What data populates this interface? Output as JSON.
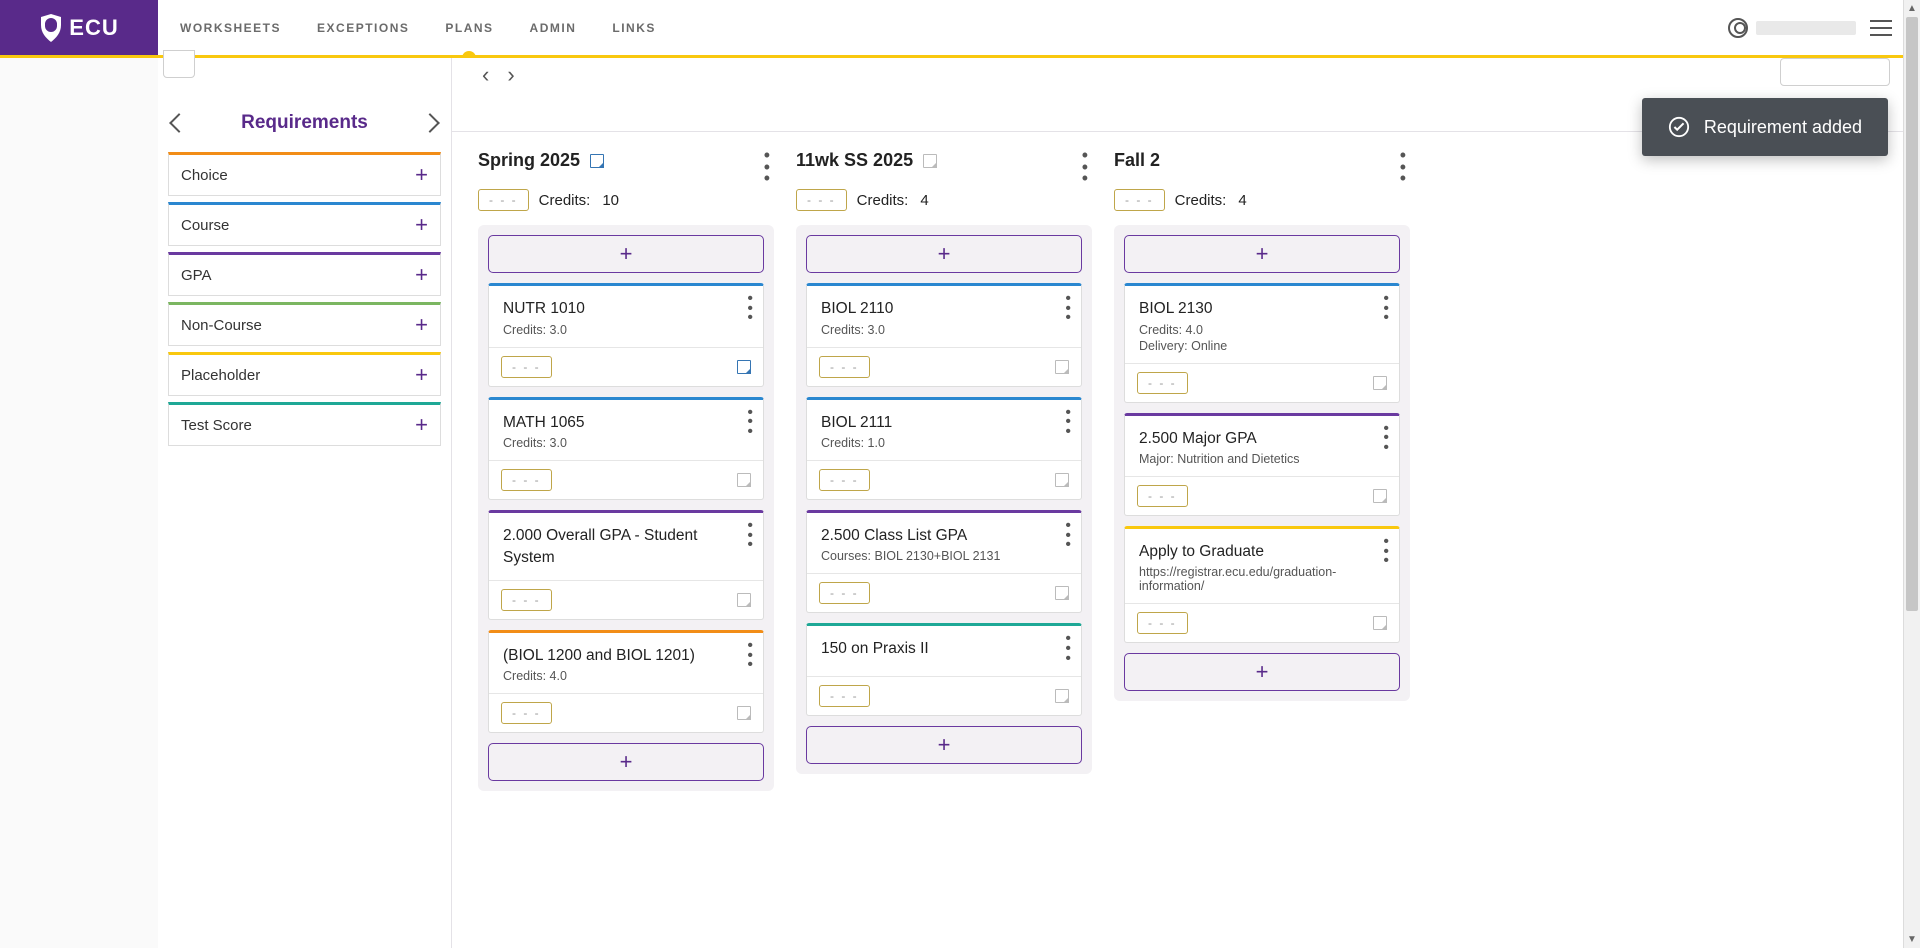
{
  "header": {
    "logo_text": "ECU",
    "nav": [
      "WORKSHEETS",
      "EXCEPTIONS",
      "PLANS",
      "ADMIN",
      "LINKS"
    ],
    "active_nav_index": 2
  },
  "toast": {
    "message": "Requirement added"
  },
  "requirements_panel": {
    "title": "Requirements",
    "items": [
      {
        "label": "Choice",
        "kind": "choice"
      },
      {
        "label": "Course",
        "kind": "course"
      },
      {
        "label": "GPA",
        "kind": "gpa"
      },
      {
        "label": "Non-Course",
        "kind": "noncourse"
      },
      {
        "label": "Placeholder",
        "kind": "placeholder"
      },
      {
        "label": "Test Score",
        "kind": "testscore"
      }
    ]
  },
  "credits_label": "Credits:",
  "dash_text": "- - -",
  "terms": [
    {
      "title": "Spring 2025",
      "note_color": "blue",
      "credits": "10",
      "cards": [
        {
          "kind": "course",
          "title": "NUTR 1010",
          "sub": "Credits: 3.0",
          "foot_note": "blue"
        },
        {
          "kind": "course",
          "title": "MATH 1065",
          "sub": "Credits: 3.0",
          "foot_note": "gray"
        },
        {
          "kind": "gpa",
          "title": "2.000 Overall GPA - Student System",
          "sub": "",
          "foot_note": "gray"
        },
        {
          "kind": "choice",
          "title": "(BIOL 1200 and BIOL 1201)",
          "sub": "Credits: 4.0",
          "foot_note": "gray"
        }
      ],
      "trailing_add": true
    },
    {
      "title": "11wk SS 2025",
      "note_color": "gray",
      "credits": "4",
      "cards": [
        {
          "kind": "course",
          "title": "BIOL 2110",
          "sub": "Credits: 3.0",
          "foot_note": "gray"
        },
        {
          "kind": "course",
          "title": "BIOL 2111",
          "sub": "Credits: 1.0",
          "foot_note": "gray"
        },
        {
          "kind": "gpa",
          "title": "2.500 Class List GPA",
          "sub": "Courses: BIOL 2130+BIOL 2131",
          "foot_note": "gray"
        },
        {
          "kind": "testscore",
          "title": "150 on Praxis II",
          "sub": "",
          "foot_note": "gray"
        }
      ],
      "trailing_add": true
    },
    {
      "title": "Fall 2",
      "note_color": "none",
      "credits": "4",
      "cards": [
        {
          "kind": "course",
          "title": "BIOL 2130",
          "sub": "Credits: 4.0",
          "sub2": "Delivery: Online",
          "foot_note": "gray"
        },
        {
          "kind": "gpa",
          "title": "2.500 Major GPA",
          "sub": "Major: Nutrition and Dietetics",
          "foot_note": "gray"
        },
        {
          "kind": "placeholder",
          "title": "Apply to Graduate",
          "sub": "https://registrar.ecu.edu/graduation-information/",
          "foot_note": "gray"
        }
      ],
      "trailing_add": true
    }
  ]
}
